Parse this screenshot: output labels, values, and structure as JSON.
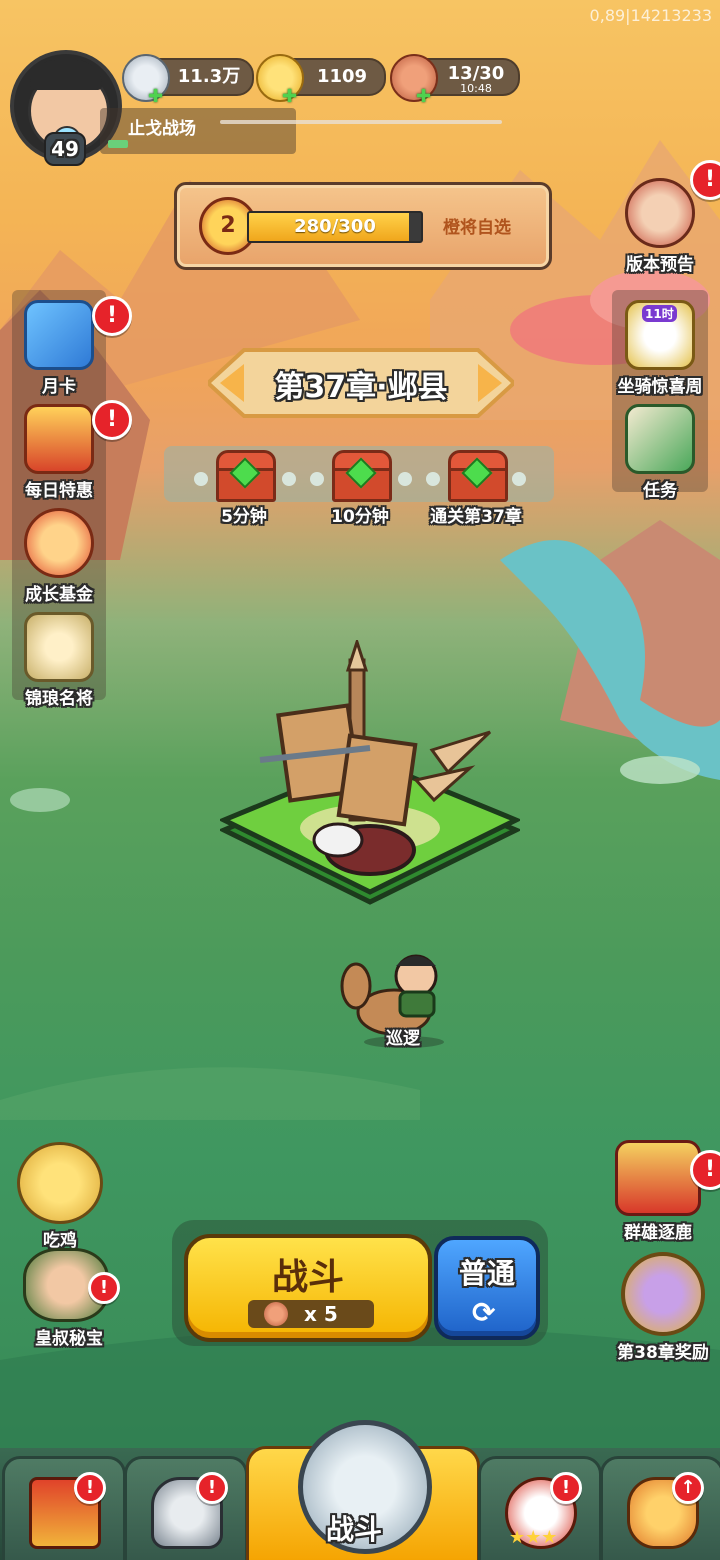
{
  "debug_text": "0,89|14213233",
  "player": {
    "level": "49",
    "area_name": "止戈战场"
  },
  "resources": [
    {
      "name": "silver",
      "icon": "silver-coin-icon",
      "value": "11.3万"
    },
    {
      "name": "gold",
      "icon": "gold-ingot-icon",
      "value": "1109"
    },
    {
      "name": "stamina",
      "icon": "meat-icon",
      "value": "13/30",
      "timer": "10:48"
    }
  ],
  "rank_bar": {
    "rank": "2",
    "progress_text": "280/300",
    "progress": 0.933,
    "button_label": "橙将自选"
  },
  "chapter": {
    "title": "第37章·邺县"
  },
  "chests": [
    {
      "label": "5分钟"
    },
    {
      "label": "10分钟"
    },
    {
      "label": "通关第37章"
    }
  ],
  "left_menu": [
    {
      "label": "月卡",
      "badge": "!"
    },
    {
      "label": "每日特惠",
      "badge": "!"
    },
    {
      "label": "成长基金",
      "badge": ""
    },
    {
      "label": "锦琅名将",
      "badge": ""
    }
  ],
  "right_menu": {
    "version_preview": {
      "label": "版本预告",
      "badge": "!"
    },
    "mount_week": {
      "label": "坐骑惊喜周",
      "tag": "11时"
    },
    "task": {
      "label": "任务"
    }
  },
  "hero_status": "巡逻",
  "bottom_left": [
    {
      "label": "吃鸡",
      "badge": ""
    },
    {
      "label": "皇叔秘宝",
      "badge": "!"
    }
  ],
  "bottom_right": [
    {
      "label": "群雄逐鹿",
      "badge": "!"
    },
    {
      "label": "第38章奖励",
      "badge": ""
    }
  ],
  "battle": {
    "button_label": "战斗",
    "cost": "x 5",
    "mode_label": "普通"
  },
  "tabs": [
    {
      "name": "city",
      "badge": "!"
    },
    {
      "name": "equipment",
      "badge": "!"
    },
    {
      "name": "battle",
      "label": "战斗"
    },
    {
      "name": "heroes",
      "badge": "!"
    },
    {
      "name": "upgrade",
      "badge": "↑"
    }
  ],
  "colors": {
    "badge_red": "#e6232a",
    "battle_yellow": "#ffd21f",
    "mode_blue": "#2e7fe0",
    "tab_green": "#3f6b56"
  }
}
